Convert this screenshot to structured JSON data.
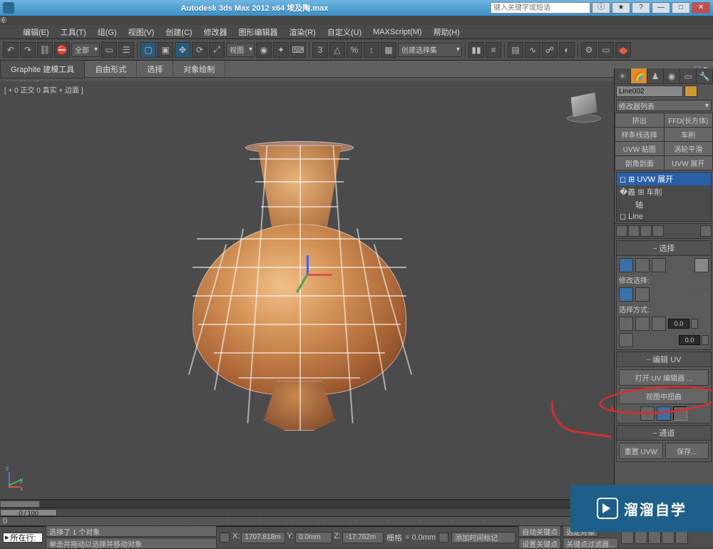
{
  "title": "Autodesk 3ds Max 2012 x64   埃及陶.max",
  "search_placeholder": "键入关键字或短语",
  "menus": [
    "编辑(E)",
    "工具(T)",
    "组(G)",
    "视图(V)",
    "创建(C)",
    "修改器",
    "图形编辑器",
    "渲染(R)",
    "自定义(U)",
    "MAXScript(M)",
    "帮助(H)"
  ],
  "toolbar": {
    "scope": "全部",
    "view_drop": "视图",
    "selset": "创建选择集"
  },
  "ribbon": {
    "tabs": [
      "Graphite 建模工具",
      "自由形式",
      "选择",
      "对象绘制"
    ],
    "sub": "多边形建模"
  },
  "viewport_label": "[ + 0 正交 0 真实 + 边面 ]",
  "axis": {
    "x": "x",
    "y": "y",
    "z": "z"
  },
  "panel": {
    "object_name": "Line002",
    "modifier_list": "修改器列表",
    "preset_buttons": [
      "挤出",
      "FFD(长方体)",
      "样条线选择",
      "车削",
      "UVW 贴图",
      "涡轮平滑",
      "剖角剖面",
      "UVW 展开"
    ],
    "stack": [
      "UVW 展开",
      "车削",
      "轴",
      "Line"
    ],
    "sel_hdr": "选择",
    "modify_sel": "修改选择:",
    "sel_method": "选择方式:",
    "spin_a": "0.0",
    "spin_b": "0.0",
    "edit_uv_hdr": "编辑 UV",
    "open_uv": "打开 UV 编辑器 ...",
    "tweak": "视图中扭曲",
    "channel_hdr": "通道",
    "reset_uvw": "重置 UVW",
    "save": "保存..."
  },
  "timeline": {
    "slider": "0 / 100",
    "first_tick": "0"
  },
  "status": {
    "sel": "选择了 1 个对象",
    "hint": "单击并拖动以选择并移动对象",
    "x_lbl": "X:",
    "x": "1707.818m",
    "y_lbl": "Y:",
    "y": "0.0mm",
    "z_lbl": "Z:",
    "z": "-17.762m",
    "grid_lbl": "栅格",
    "grid": "= 0.0mm",
    "autokey": "自动关键点",
    "selkey": "选定对象",
    "setkey": "设置关键点",
    "keyfilter": "关键点过滤器...",
    "addtime": "添加时间标记",
    "cur_row": "所在行:"
  },
  "watermark": "溜溜自学"
}
